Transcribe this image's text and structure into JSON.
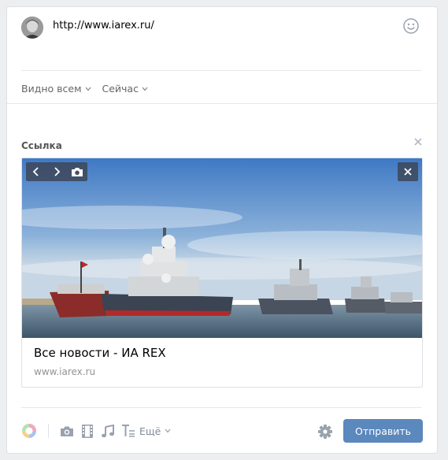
{
  "post": {
    "text": "http://www.iarex.ru/"
  },
  "meta": {
    "visibility_label": "Видно всем",
    "time_label": "Сейчас"
  },
  "attachment": {
    "section_title": "Ссылка",
    "link_title": "Все новости - ИА REX",
    "link_domain": "www.iarex.ru"
  },
  "toolbar": {
    "more_label": "Ещё",
    "send_label": "Отправить",
    "icons": [
      "graffiti-icon",
      "camera-icon",
      "video-icon",
      "music-icon",
      "text-format-icon"
    ]
  },
  "colors": {
    "accent": "#5b88bd",
    "muted": "#828a99",
    "icon": "#99a2ad"
  }
}
